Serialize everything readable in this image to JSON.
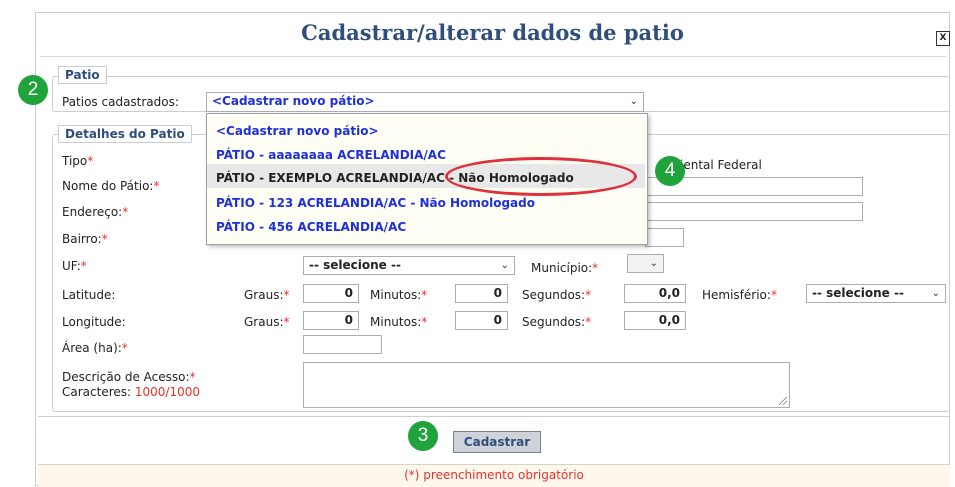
{
  "dialog": {
    "title": "Cadastrar/alterar dados de patio",
    "close_label": "X"
  },
  "patio_section": {
    "legend": "Patio",
    "label": "Patios cadastrados:",
    "selected": "<Cadastrar novo pátio>"
  },
  "dropdown": {
    "options": [
      "<Cadastrar novo pátio>",
      "PÁTIO - aaaaaaaa ACRELANDIA/AC",
      "PÁTIO - EXEMPLO ACRELANDIA/AC - Não Homologado",
      "PÁTIO - 123 ACRELANDIA/AC - Não Homologado",
      "PÁTIO - 456 ACRELANDIA/AC"
    ],
    "highlighted_index": 2
  },
  "details": {
    "legend": "Detalhes do Patio",
    "tipo_label": "Tipo",
    "tipo_partial_text": "iental Federal",
    "nome_label": "Nome do Pátio:",
    "endereco_label": "Endereço:",
    "bairro_label": "Bairro:",
    "uf_label": "UF:",
    "uf_value": "-- selecione --",
    "municipio_label": "Município:",
    "latitude_label": "Latitude:",
    "longitude_label": "Longitude:",
    "graus_label": "Graus:",
    "minutos_label": "Minutos:",
    "segundos_label": "Segundos:",
    "hemisferio_label": "Hemisfério:",
    "hemisferio_value": "-- selecione --",
    "lat_graus": "0",
    "lat_minutos": "0",
    "lat_segundos": "0,0",
    "lon_graus": "0",
    "lon_minutos": "0",
    "lon_segundos": "0,0",
    "area_label": "Área (ha):",
    "descricao_label": "Descrição de Acesso:",
    "caracteres_label": "Caracteres:",
    "caracteres_value": "1000/1000",
    "required_mark": "*"
  },
  "actions": {
    "submit_label": "Cadastrar"
  },
  "footer": {
    "note": "(*) preenchimento obrigatório"
  },
  "annotations": {
    "badge_2": "2",
    "badge_3": "3",
    "badge_4": "4"
  },
  "colors": {
    "title": "#2f4e7c",
    "required": "#e8312a",
    "option_link": "#1f30d8",
    "badge": "#20a33a",
    "highlight_ring": "#e0303a"
  }
}
